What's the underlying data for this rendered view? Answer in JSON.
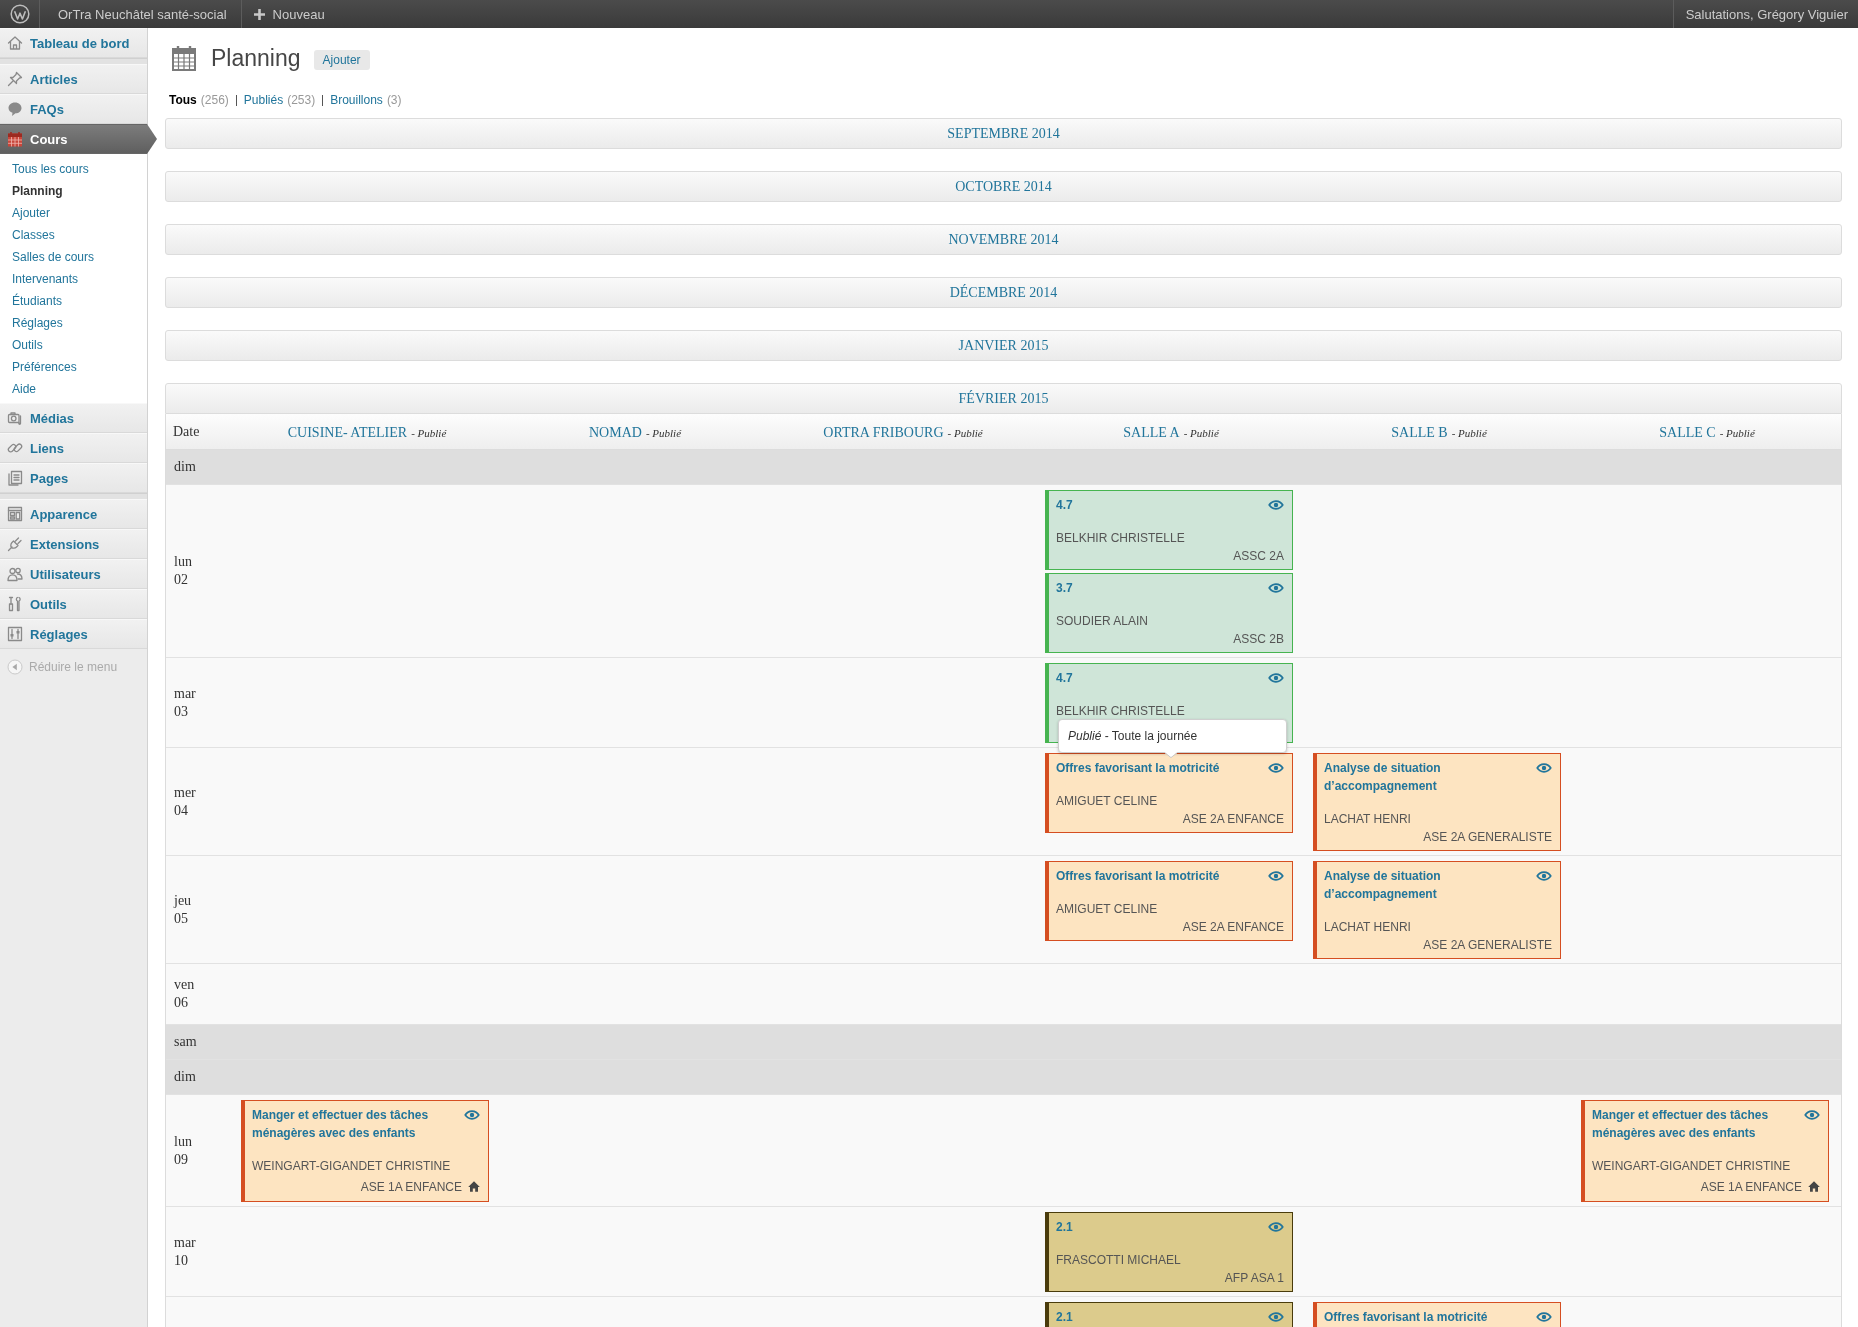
{
  "topbar": {
    "site_name": "OrTra Neuchâtel santé-social",
    "new_label": "Nouveau",
    "greeting": "Salutations, Grégory Viguier"
  },
  "sidebar": {
    "groups": [
      {
        "items": [
          {
            "label": "Tableau de bord",
            "selected": false
          }
        ]
      },
      {
        "items": [
          {
            "label": "Articles",
            "selected": false
          },
          {
            "label": "FAQs",
            "selected": false
          },
          {
            "label": "Cours",
            "selected": true,
            "children": [
              {
                "label": "Tous les cours",
                "selected": false
              },
              {
                "label": "Planning",
                "selected": true
              },
              {
                "label": "Ajouter",
                "selected": false
              },
              {
                "label": "Classes",
                "selected": false
              },
              {
                "label": "Salles de cours",
                "selected": false
              },
              {
                "label": "Intervenants",
                "selected": false
              },
              {
                "label": "Étudiants",
                "selected": false
              },
              {
                "label": "Réglages",
                "selected": false
              },
              {
                "label": "Outils",
                "selected": false
              },
              {
                "label": "Préférences",
                "selected": false
              },
              {
                "label": "Aide",
                "selected": false
              }
            ]
          },
          {
            "label": "Médias",
            "selected": false
          },
          {
            "label": "Liens",
            "selected": false
          },
          {
            "label": "Pages",
            "selected": false
          }
        ]
      },
      {
        "items": [
          {
            "label": "Apparence",
            "selected": false
          },
          {
            "label": "Extensions",
            "selected": false
          },
          {
            "label": "Utilisateurs",
            "selected": false
          },
          {
            "label": "Outils",
            "selected": false
          },
          {
            "label": "Réglages",
            "selected": false
          }
        ]
      }
    ],
    "collapse_label": "Réduire le menu"
  },
  "page": {
    "title": "Planning",
    "add_button": "Ajouter",
    "filters": [
      {
        "label": "Tous",
        "count": "(256)",
        "selected": true
      },
      {
        "label": "Publiés",
        "count": "(253)",
        "selected": false
      },
      {
        "label": "Brouillons",
        "count": "(3)",
        "selected": false
      }
    ]
  },
  "months": [
    {
      "label": "SEPTEMBRE 2014",
      "expanded": false
    },
    {
      "label": "OCTOBRE 2014",
      "expanded": false
    },
    {
      "label": "NOVEMBRE 2014",
      "expanded": false
    },
    {
      "label": "DÉCEMBRE 2014",
      "expanded": false
    },
    {
      "label": "JANVIER 2015",
      "expanded": false
    },
    {
      "label": "FÉVRIER 2015",
      "expanded": true,
      "date_heading": "Date",
      "columns": [
        {
          "name": "CUISINE- ATELIER",
          "status": "- *Publié*"
        },
        {
          "name": "NOMAD",
          "status": "- *Publié*"
        },
        {
          "name": "ORTRA FRIBOURG",
          "status": "- *Publié*"
        },
        {
          "name": "SALLE A",
          "status": "- *Publié*"
        },
        {
          "name": "SALLE B",
          "status": "- *Publié*"
        },
        {
          "name": "SALLE C",
          "status": "- *Publié*"
        }
      ],
      "rows": [
        {
          "day": "dim",
          "weekend": true
        },
        {
          "day": "lun",
          "date": "02",
          "weekend": false,
          "cells": [
            {},
            {},
            {},
            {
              "events": [
                {
                  "title": "4.7",
                  "person": "BELKHIR CHRISTELLE",
                  "class": "ASSC 2A",
                  "color": "#46b450",
                  "home": false
                },
                {
                  "title": "3.7",
                  "person": "SOUDIER ALAIN",
                  "class": "ASSC 2B",
                  "color": "#46b450",
                  "home": false
                }
              ]
            },
            {},
            {}
          ]
        },
        {
          "day": "mar",
          "date": "03",
          "weekend": false,
          "cells": [
            {},
            {},
            {},
            {
              "events": [
                {
                  "title": "4.7",
                  "person": "BELKHIR CHRISTELLE",
                  "color": "#46b450",
                  "home": false
                }
              ]
            },
            {},
            {}
          ]
        },
        {
          "day": "mer",
          "date": "04",
          "weekend": false,
          "cells": [
            {},
            {},
            {},
            {
              "events": [
                {
                  "title": "Offres favorisant la motricité",
                  "person": "AMIGUET CELINE",
                  "class": "ASE 2A ENFANCE",
                  "color": "#d54e21",
                  "home": false,
                  "tooltip": "*Publié* - Toute la journée"
                }
              ]
            },
            {
              "events": [
                {
                  "title": "Analyse de situation d’accompagnement",
                  "person": "LACHAT HENRI",
                  "class": "ASE 2A GENERALISTE",
                  "color": "#d54e21",
                  "home": false
                }
              ]
            },
            {}
          ]
        },
        {
          "day": "jeu",
          "date": "05",
          "weekend": false,
          "cells": [
            {},
            {},
            {},
            {
              "events": [
                {
                  "title": "Offres favorisant la motricité",
                  "person": "AMIGUET CELINE",
                  "class": "ASE 2A ENFANCE",
                  "color": "#d54e21",
                  "home": false
                }
              ]
            },
            {
              "events": [
                {
                  "title": "Analyse de situation d’accompagnement",
                  "person": "LACHAT HENRI",
                  "class": "ASE 2A GENERALISTE",
                  "color": "#d54e21",
                  "home": false
                }
              ]
            },
            {}
          ]
        },
        {
          "day": "ven",
          "date": "06",
          "weekend": false
        },
        {
          "day": "sam",
          "weekend": true
        },
        {
          "day": "dim",
          "weekend": true
        },
        {
          "day": "lun",
          "date": "09",
          "weekend": false,
          "cells": [
            {
              "events": [
                {
                  "title": "Manger et effectuer des tâches ménagères avec des enfants",
                  "person": "WEINGART-GIGANDET CHRISTINE",
                  "class": "ASE 1A ENFANCE",
                  "color": "#d54e21",
                  "home": true
                }
              ]
            },
            {},
            {},
            {},
            {},
            {
              "events": [
                {
                  "title": "Manger et effectuer des tâches ménagères avec des enfants",
                  "person": "WEINGART-GIGANDET CHRISTINE",
                  "class": "ASE 1A ENFANCE",
                  "color": "#d54e21",
                  "home": true
                }
              ]
            }
          ]
        },
        {
          "day": "mar",
          "date": "10",
          "weekend": false,
          "cells": [
            {},
            {},
            {},
            {
              "events": [
                {
                  "title": "2.1",
                  "person": "FRASCOTTI MICHAEL",
                  "class": "AFP ASA 1",
                  "color": "#4a3c0c",
                  "home": false
                }
              ]
            },
            {},
            {}
          ]
        },
        {
          "weekend": false,
          "cells": [
            {},
            {},
            {},
            {
              "events": [
                {
                  "title": "2.1",
                  "color": "#4a3c0c",
                  "home": false
                }
              ]
            },
            {
              "events": [
                {
                  "title": "Offres favorisant la motricité",
                  "color": "#d54e21",
                  "home": false
                }
              ]
            },
            {}
          ]
        }
      ]
    }
  ]
}
